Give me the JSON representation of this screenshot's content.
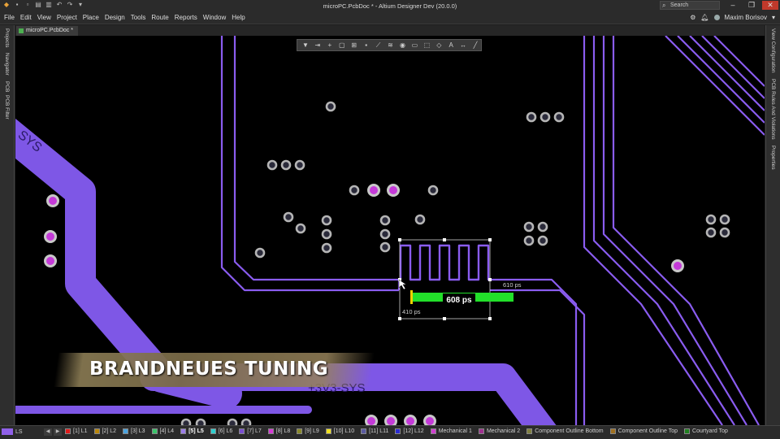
{
  "window": {
    "title": "microPC.PcbDoc * - Altium Designer Dev (20.0.0)",
    "search_placeholder": "Search",
    "user": "Maxim Borisov"
  },
  "menu": [
    "File",
    "Edit",
    "View",
    "Project",
    "Place",
    "Design",
    "Tools",
    "Route",
    "Reports",
    "Window",
    "Help"
  ],
  "left_panel_tabs": [
    "Projects",
    "Navigator",
    "PCB",
    "PCB Filter"
  ],
  "right_panel_tabs": [
    "View Configuration",
    "PCB Rules And Violations",
    "Properties"
  ],
  "document_tab": "microPC.PcbDoc *",
  "canvas": {
    "net_label_top": "SYS",
    "net_label_bottom": "+3V3-SYS",
    "tuning": {
      "current_delay": "608 ps",
      "min_delay": "410 ps",
      "max_delay": "610 ps"
    },
    "banner": "BRANDNEUES TUNING"
  },
  "colors": {
    "track": "#8a5cf0",
    "wide_track": "#7e57e6",
    "gauge_green": "#22e02a",
    "gauge_marker": "#f0d000",
    "via_ring": "#b5b5b5"
  },
  "layer_bar": {
    "current": "LS",
    "layers": [
      {
        "label": "[1] L1",
        "color": "#e01b1b"
      },
      {
        "label": "[2] L2",
        "color": "#b8860b"
      },
      {
        "label": "[3] L3",
        "color": "#4aa3df"
      },
      {
        "label": "[4] L4",
        "color": "#3bc46b"
      },
      {
        "label": "[5] L5",
        "color": "#9b7de8"
      },
      {
        "label": "[6] L6",
        "color": "#2ecfcf"
      },
      {
        "label": "[7] L7",
        "color": "#7a4fd0"
      },
      {
        "label": "[8] L8",
        "color": "#d63ad6"
      },
      {
        "label": "[9] L9",
        "color": "#8a8a2a"
      },
      {
        "label": "[10] L10",
        "color": "#f0e020"
      },
      {
        "label": "[11] L11",
        "color": "#5a5aa0"
      },
      {
        "label": "[12] L12",
        "color": "#2a2ad0"
      },
      {
        "label": "Mechanical 1",
        "color": "#d040d0"
      },
      {
        "label": "Mechanical 2",
        "color": "#a03090"
      },
      {
        "label": "Component Outline Bottom",
        "color": "#808040"
      },
      {
        "label": "Component Outline Top",
        "color": "#a07020"
      },
      {
        "label": "Courtyard Top",
        "color": "#208020"
      }
    ]
  }
}
